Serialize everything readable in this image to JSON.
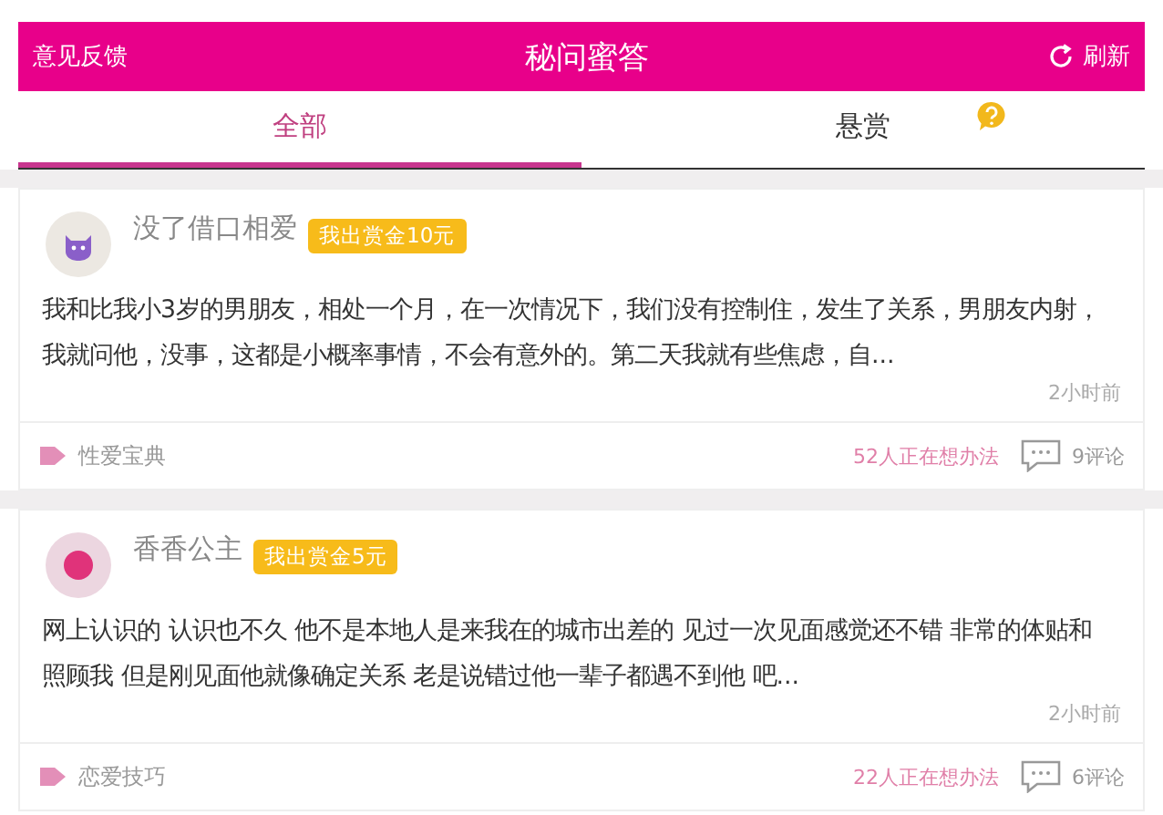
{
  "header": {
    "left": "意见反馈",
    "title": "秘问蜜答",
    "right": "刷新"
  },
  "tabs": [
    {
      "label": "全部",
      "selected": true
    },
    {
      "label": "悬赏",
      "selected": false
    }
  ],
  "posts": [
    {
      "name": "没了借口相爱",
      "reward": "我出赏金10元",
      "avatar": {
        "kind": "cat"
      },
      "body": "我和比我小3岁的男朋友，相处一个月，在一次情况下，我们没有控制住，发生了关系，男朋友内射，我就问他，没事，这都是小概率事情，不会有意外的。第二天我就有些焦虑，自...",
      "time": "2小时前",
      "category": "性爱宝典",
      "thinking": "52人正在想办法",
      "comments": "9评论"
    },
    {
      "name": "香香公主",
      "reward": "我出赏金5元",
      "avatar": {
        "kind": "face"
      },
      "body": "网上认识的 认识也不久 他不是本地人是来我在的城市出差的 见过一次见面感觉还不错 非常的体贴和照顾我 但是刚见面他就像确定关系 老是说错过他一辈子都遇不到他 吧...",
      "time": "2小时前",
      "category": "恋爱技巧",
      "thinking": "22人正在想办法",
      "comments": "6评论"
    }
  ]
}
